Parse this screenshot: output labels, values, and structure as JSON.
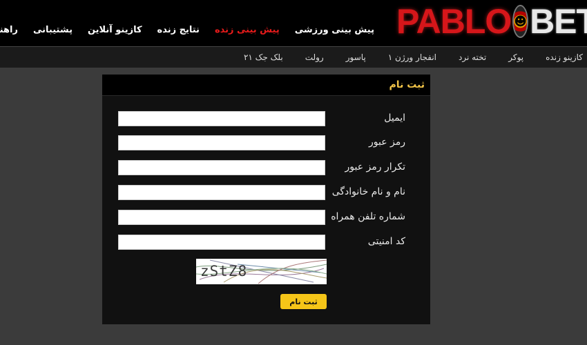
{
  "brand": {
    "part1": "PABLO",
    "part2": "BET"
  },
  "main_nav": [
    {
      "label": "پیش بینی ورزشی",
      "active": false
    },
    {
      "label": "پیش بینی زنده",
      "active": true
    },
    {
      "label": "نتایج زنده",
      "active": false
    },
    {
      "label": "کازینو آنلاین",
      "active": false
    },
    {
      "label": "پشتیبانی",
      "active": false
    },
    {
      "label": "راهنما",
      "active": false
    }
  ],
  "sub_nav": [
    "کازینو زنده",
    "پوکر",
    "تخته نرد",
    "انفجار ورژن ۱",
    "پاسور",
    "رولت",
    "بلک جک ۲۱"
  ],
  "form": {
    "title": "ثبت نام",
    "fields": [
      {
        "label": "ایمیل",
        "value": ""
      },
      {
        "label": "رمز عبور",
        "value": ""
      },
      {
        "label": "تکرار رمز عبور",
        "value": ""
      },
      {
        "label": "نام و نام خانوادگی",
        "value": ""
      },
      {
        "label": "شماره تلفن همراه",
        "value": ""
      },
      {
        "label": "کد امنیتی",
        "value": ""
      }
    ],
    "captcha_text": "zStZ8",
    "submit_label": "ثبت نام"
  },
  "colors": {
    "accent_red": "#e81b1b",
    "header_gold": "#f2c448",
    "button_yellow": "#f5c518"
  }
}
